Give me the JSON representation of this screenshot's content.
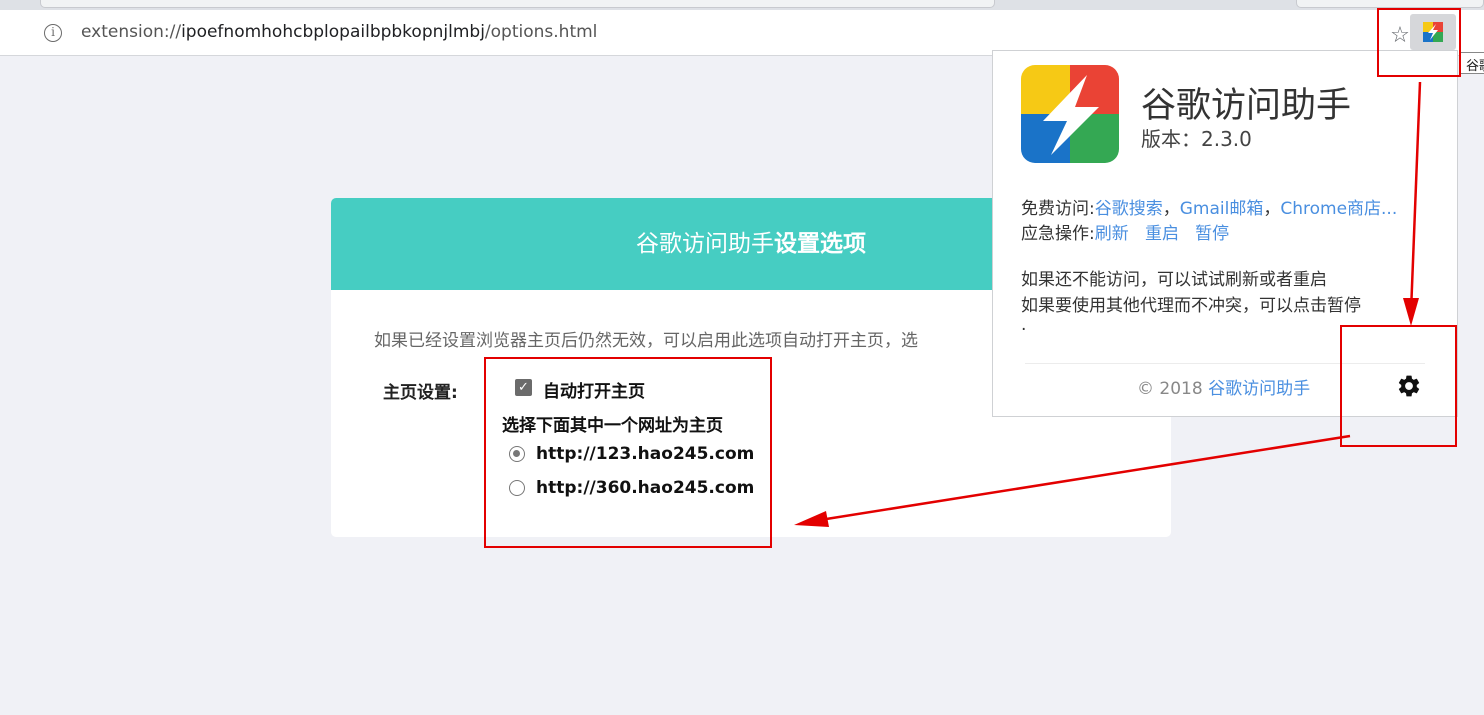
{
  "browser": {
    "url_scheme": "extension://",
    "url_host": "ipoefnomhohcbplopailbpbkopnjlmbj",
    "url_path": "/options.html",
    "tooltip": "谷歌访问助手"
  },
  "options_page": {
    "header_normal": "谷歌访问助手",
    "header_bold": "设置选项",
    "description": "如果已经设置浏览器主页后仍然无效，可以启用此选项自动打开主页，选",
    "homepage_label": "主页设置:",
    "auto_open_label": "自动打开主页",
    "auto_open_checked": true,
    "choose_label": "选择下面其中一个网址为主页",
    "urls": [
      {
        "label": "http://123.hao245.com",
        "selected": true
      },
      {
        "label": "http://360.hao245.com",
        "selected": false
      }
    ]
  },
  "popup": {
    "name": "谷歌访问助手",
    "version_label": "版本：",
    "version": "2.3.0",
    "free_access_label": "免费访问:",
    "free_access_links": [
      "谷歌搜索",
      "Gmail邮箱",
      "Chrome商店..."
    ],
    "emergency_label": "应急操作:",
    "emergency_links": [
      "刷新",
      "重启",
      "暂停"
    ],
    "tip_line1": "如果还不能访问，可以试试刷新或者重启",
    "tip_line2": "如果要使用其他代理而不冲突，可以点击暂停",
    "tip_line3": ".",
    "copyright_prefix": "© 2018 ",
    "copyright_link": "谷歌访问助手"
  },
  "colors": {
    "header_teal": "#46cdc2",
    "link_blue": "#4a8fe0",
    "annotation_red": "#e30000"
  }
}
